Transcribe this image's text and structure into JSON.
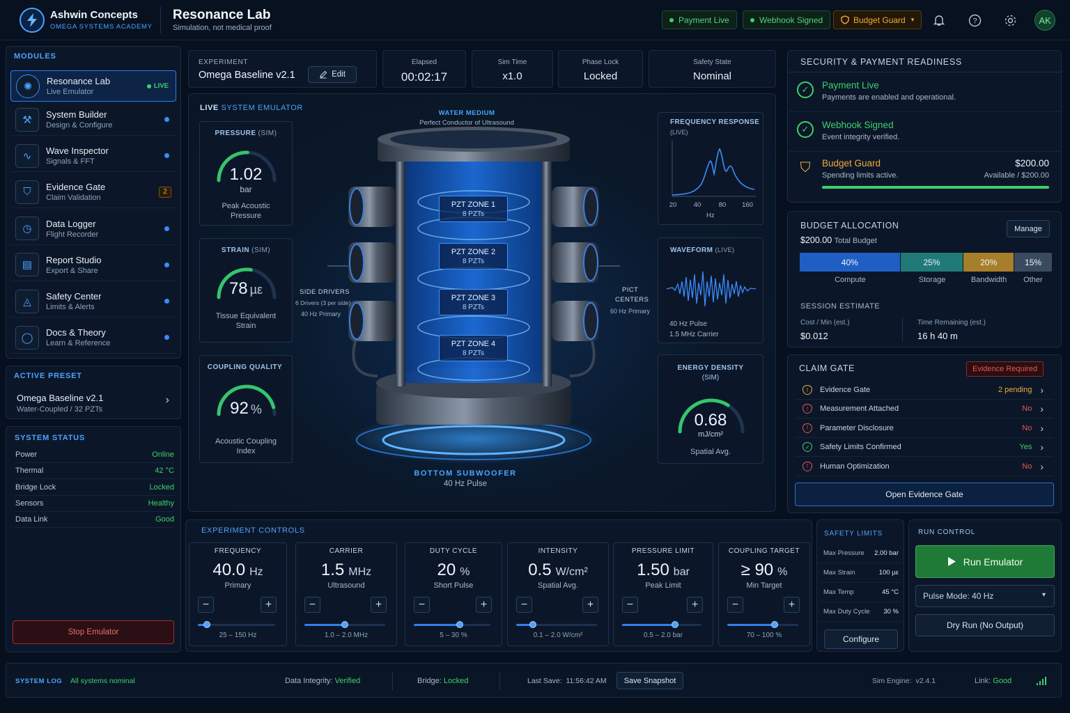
{
  "header": {
    "brand_name": "Ashwin Concepts",
    "brand_sub": "OMEGA SYSTEMS ACADEMY",
    "app_title": "Resonance Lab",
    "app_subtitle": "Simulation, not medical proof",
    "pills": {
      "payment": "Payment Live",
      "webhook": "Webhook Signed",
      "budget": "Budget Guard"
    },
    "avatar": "AK"
  },
  "sidebar": {
    "modules_title": "MODULES",
    "items": [
      {
        "name": "Resonance Lab",
        "sub": "Live Emulator",
        "badge": "LIVE"
      },
      {
        "name": "System Builder",
        "sub": "Design & Configure"
      },
      {
        "name": "Wave Inspector",
        "sub": "Signals & FFT"
      },
      {
        "name": "Evidence Gate",
        "sub": "Claim Validation",
        "badge": "2"
      },
      {
        "name": "Data Logger",
        "sub": "Flight Recorder"
      },
      {
        "name": "Report Studio",
        "sub": "Export & Share"
      },
      {
        "name": "Safety Center",
        "sub": "Limits & Alerts"
      },
      {
        "name": "Docs & Theory",
        "sub": "Learn & Reference"
      }
    ],
    "preset_title": "ACTIVE PRESET",
    "preset_name": "Omega Baseline v2.1",
    "preset_sub": "Water-Coupled / 32 PZTs",
    "status_title": "SYSTEM STATUS",
    "status": [
      {
        "label": "Power",
        "value": "Online"
      },
      {
        "label": "Thermal",
        "value": "42 °C"
      },
      {
        "label": "Bridge Lock",
        "value": "Locked"
      },
      {
        "label": "Sensors",
        "value": "Healthy"
      },
      {
        "label": "Data Link",
        "value": "Good"
      }
    ],
    "stop_label": "Stop Emulator"
  },
  "topbar": {
    "experiment_label": "EXPERIMENT",
    "experiment_name": "Omega Baseline v2.1",
    "edit_label": "Edit",
    "metrics": [
      {
        "label": "Elapsed",
        "value": "00:02:17"
      },
      {
        "label": "Sim Time",
        "value": "x1.0"
      },
      {
        "label": "Phase Lock",
        "value": "Locked"
      },
      {
        "label": "Safety State",
        "value": "Nominal"
      }
    ]
  },
  "emulator": {
    "title_a": "LIVE",
    "title_b": " SYSTEM EMULATOR",
    "gauges": [
      {
        "title": "PRESSURE",
        "tag": "(SIM)",
        "value": "1.02",
        "unit": "bar",
        "sub": "Peak Acoustic Pressure",
        "level": 0.51
      },
      {
        "title": "STRAIN",
        "tag": "(SIM)",
        "value": "78",
        "unit": "µε",
        "sub": "Tissue Equivalent Strain",
        "level": 0.55
      },
      {
        "title": "COUPLING QUALITY",
        "tag": "",
        "value": "92",
        "unit": "%",
        "sub": "Acoustic Coupling Index",
        "level": 0.92
      }
    ],
    "water_title": "WATER MEDIUM",
    "water_sub": "Perfect Conductor of Ultrasound",
    "zones": [
      {
        "name": "PZT ZONE 1",
        "count": "8 PZTs"
      },
      {
        "name": "PZT ZONE 2",
        "count": "8 PZTs"
      },
      {
        "name": "PZT ZONE 3",
        "count": "8 PZTs"
      },
      {
        "name": "PZT ZONE 4",
        "count": "8 PZTs"
      }
    ],
    "side_title": "SIDE DRIVERS",
    "side_sub1": "6 Drivers (3 per side)",
    "side_sub2": "40 Hz Primary",
    "right_title1": "PICT",
    "right_title2": "CENTERS",
    "right_sub": "60 Hz Primary",
    "bottom_title": "BOTTOM SUBWOOFER",
    "bottom_sub": "40 Hz Pulse",
    "freq_title": "FREQUENCY RESPONSE",
    "freq_tag": "(LIVE)",
    "freq_ticks": [
      "20",
      "40",
      "80",
      "160"
    ],
    "freq_unit": "Hz",
    "wave_title": "WAVEFORM",
    "wave_tag": "(LIVE)",
    "wave_sub1": "40 Hz Pulse",
    "wave_sub2": "1.5 MHz Carrier",
    "energy_title1": "ENERGY DENSITY",
    "energy_title2": "(SIM)",
    "energy_value": "0.68",
    "energy_unit": "mJ/cm²",
    "energy_sub": "Spatial Avg.",
    "energy_level": 0.68
  },
  "security": {
    "title": "SECURITY & PAYMENT READINESS",
    "rows": [
      {
        "title": "Payment Live",
        "sub": "Payments are enabled and operational."
      },
      {
        "title": "Webhook Signed",
        "sub": "Event integrity verified."
      },
      {
        "title": "Budget Guard",
        "sub": "Spending limits active.",
        "amount": "$200.00",
        "avail": "Available / $200.00",
        "level": 1.0
      }
    ]
  },
  "budget": {
    "title": "BUDGET ALLOCATION",
    "manage_label": "Manage",
    "total_value": "$200.00",
    "total_label": "Total Budget",
    "segments": [
      {
        "pct": "40%",
        "label": "Compute",
        "color": "#1f5fc4",
        "share": 40
      },
      {
        "pct": "25%",
        "label": "Storage",
        "color": "#1f7a78",
        "share": 25
      },
      {
        "pct": "20%",
        "label": "Bandwidth",
        "color": "#a77f2a",
        "share": 20
      },
      {
        "pct": "15%",
        "label": "Other",
        "color": "#3a4b60",
        "share": 15
      }
    ],
    "session_title": "SESSION ESTIMATE",
    "cost_label": "Cost / Min (est.)",
    "cost_value": "$0.012",
    "time_label": "Time Remaining (est.)",
    "time_value": "16 h 40 m"
  },
  "claim": {
    "title": "CLAIM GATE",
    "badge": "Evidence Required",
    "rows": [
      {
        "label": "Evidence Gate",
        "value": "2 pending",
        "kind": "amber"
      },
      {
        "label": "Measurement Attached",
        "value": "No",
        "kind": "red"
      },
      {
        "label": "Parameter Disclosure",
        "value": "No",
        "kind": "red"
      },
      {
        "label": "Safety Limits Confirmed",
        "value": "Yes",
        "kind": "green"
      },
      {
        "label": "Human Optimization",
        "value": "No",
        "kind": "red"
      }
    ],
    "open_label": "Open Evidence Gate"
  },
  "controls": {
    "title": "EXPERIMENT CONTROLS",
    "items": [
      {
        "title": "FREQUENCY",
        "value": "40.0",
        "unit": "Hz",
        "sub": "Primary",
        "range": "25 – 150 Hz",
        "level": 0.12
      },
      {
        "title": "CARRIER",
        "value": "1.5",
        "unit": "MHz",
        "sub": "Ultrasound",
        "range": "1.0 – 2.0 MHz",
        "level": 0.5
      },
      {
        "title": "DUTY CYCLE",
        "value": "20",
        "unit": "%",
        "sub": "Short Pulse",
        "range": "5 – 30 %",
        "level": 0.6
      },
      {
        "title": "INTENSITY",
        "value": "0.5",
        "unit": "W/cm²",
        "sub": "Spatial Avg.",
        "range": "0.1 – 2.0 W/cm²",
        "level": 0.21
      },
      {
        "title": "PRESSURE LIMIT",
        "value": "1.50",
        "unit": "bar",
        "sub": "Peak Limit",
        "range": "0.5 – 2.0 bar",
        "level": 0.67
      },
      {
        "title": "COUPLING TARGET",
        "value": "≥ 90",
        "unit": "%",
        "sub": "Min Target",
        "range": "70 – 100 %",
        "level": 0.67
      }
    ]
  },
  "limits": {
    "title": "SAFETY LIMITS",
    "rows": [
      {
        "label": "Max Pressure",
        "value": "2.00 bar"
      },
      {
        "label": "Max Strain",
        "value": "100 µε"
      },
      {
        "label": "Max Temp",
        "value": "45 °C"
      },
      {
        "label": "Max Duty Cycle",
        "value": "30 %"
      }
    ],
    "configure_label": "Configure"
  },
  "run": {
    "title": "RUN CONTROL",
    "run_label": "Run Emulator",
    "pulse_mode": "Pulse Mode: 40 Hz",
    "dry_label": "Dry Run (No Output)"
  },
  "footer": {
    "log_label": "SYSTEM LOG",
    "log_msg": "All systems nominal",
    "integrity_label": "Data Integrity:",
    "integrity_value": "Verified",
    "bridge_label": "Bridge:",
    "bridge_value": "Locked",
    "last_save": "Last Save:  11:56:42 AM",
    "snapshot_label": "Save Snapshot",
    "engine": "Sim Engine:  v2.4.1",
    "link_label": "Link:",
    "link_value": "Good"
  },
  "colors": {
    "accent": "#4da3ff",
    "ok": "#3fcf6e",
    "warn": "#f2a93b",
    "bad": "#f0524d"
  }
}
